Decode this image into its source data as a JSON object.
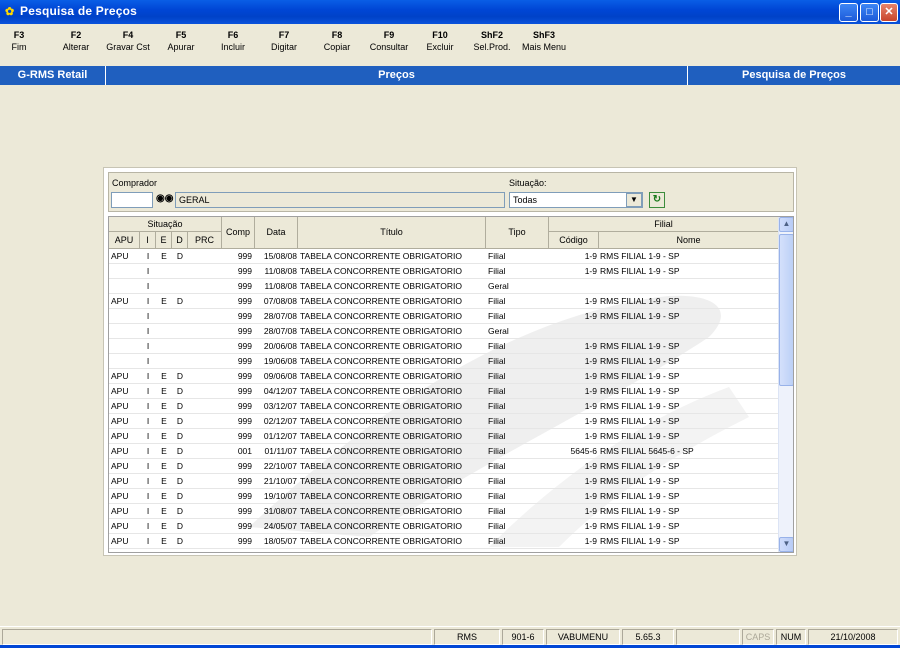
{
  "window": {
    "title": "Pesquisa de Preços"
  },
  "fkeys": [
    {
      "key": "F3",
      "label": "Fim"
    },
    {
      "key": "F2",
      "label": "Alterar"
    },
    {
      "key": "F4",
      "label": "Gravar Cst"
    },
    {
      "key": "F5",
      "label": "Apurar"
    },
    {
      "key": "F6",
      "label": "Incluir"
    },
    {
      "key": "F7",
      "label": "Digitar"
    },
    {
      "key": "F8",
      "label": "Copiar"
    },
    {
      "key": "F9",
      "label": "Consultar"
    },
    {
      "key": "F10",
      "label": "Excluir"
    },
    {
      "key": "ShF2",
      "label": "Sel.Prod."
    },
    {
      "key": "ShF3",
      "label": "Mais Menu"
    }
  ],
  "header": {
    "app": "G-RMS Retail",
    "module": "Preços",
    "screen": "Pesquisa de Preços"
  },
  "filter": {
    "comprador_label": "Comprador",
    "comprador_value": "",
    "comprador_name": "GERAL",
    "situacao_label": "Situação:",
    "situacao_value": "Todas"
  },
  "grid": {
    "group_situacao": "Situação",
    "group_filial": "Filial",
    "columns": {
      "apu": "APU",
      "i": "I",
      "e": "E",
      "d": "D",
      "prc": "PRC",
      "comp": "Comp",
      "data": "Data",
      "titulo": "Título",
      "tipo": "Tipo",
      "codigo": "Código",
      "nome": "Nome"
    },
    "rows": [
      {
        "apu": "APU",
        "i": "I",
        "e": "E",
        "d": "D",
        "prc": "",
        "comp": "999",
        "data": "15/08/08",
        "titulo": "TABELA CONCORRENTE OBRIGATORIO",
        "tipo": "Filial",
        "codigo": "1-9",
        "nome": "RMS FILIAL 1-9 - SP"
      },
      {
        "apu": "",
        "i": "I",
        "e": "",
        "d": "",
        "prc": "",
        "comp": "999",
        "data": "11/08/08",
        "titulo": "TABELA CONCORRENTE OBRIGATORIO",
        "tipo": "Filial",
        "codigo": "1-9",
        "nome": "RMS FILIAL 1-9 - SP"
      },
      {
        "apu": "",
        "i": "I",
        "e": "",
        "d": "",
        "prc": "",
        "comp": "999",
        "data": "11/08/08",
        "titulo": "TABELA CONCORRENTE OBRIGATORIO",
        "tipo": "Geral",
        "codigo": "",
        "nome": ""
      },
      {
        "apu": "APU",
        "i": "I",
        "e": "E",
        "d": "D",
        "prc": "",
        "comp": "999",
        "data": "07/08/08",
        "titulo": "TABELA CONCORRENTE OBRIGATORIO",
        "tipo": "Filial",
        "codigo": "1-9",
        "nome": "RMS FILIAL 1-9 - SP"
      },
      {
        "apu": "",
        "i": "I",
        "e": "",
        "d": "",
        "prc": "",
        "comp": "999",
        "data": "28/07/08",
        "titulo": "TABELA CONCORRENTE OBRIGATORIO",
        "tipo": "Filial",
        "codigo": "1-9",
        "nome": "RMS FILIAL 1-9 - SP"
      },
      {
        "apu": "",
        "i": "I",
        "e": "",
        "d": "",
        "prc": "",
        "comp": "999",
        "data": "28/07/08",
        "titulo": "TABELA CONCORRENTE OBRIGATORIO",
        "tipo": "Geral",
        "codigo": "",
        "nome": ""
      },
      {
        "apu": "",
        "i": "I",
        "e": "",
        "d": "",
        "prc": "",
        "comp": "999",
        "data": "20/06/08",
        "titulo": "TABELA CONCORRENTE OBRIGATORIO",
        "tipo": "Filial",
        "codigo": "1-9",
        "nome": "RMS FILIAL 1-9 - SP"
      },
      {
        "apu": "",
        "i": "I",
        "e": "",
        "d": "",
        "prc": "",
        "comp": "999",
        "data": "19/06/08",
        "titulo": "TABELA CONCORRENTE OBRIGATORIO",
        "tipo": "Filial",
        "codigo": "1-9",
        "nome": "RMS FILIAL 1-9 - SP"
      },
      {
        "apu": "APU",
        "i": "I",
        "e": "E",
        "d": "D",
        "prc": "",
        "comp": "999",
        "data": "09/06/08",
        "titulo": "TABELA CONCORRENTE OBRIGATORIO",
        "tipo": "Filial",
        "codigo": "1-9",
        "nome": "RMS FILIAL 1-9 - SP"
      },
      {
        "apu": "APU",
        "i": "I",
        "e": "E",
        "d": "D",
        "prc": "",
        "comp": "999",
        "data": "04/12/07",
        "titulo": "TABELA CONCORRENTE OBRIGATORIO",
        "tipo": "Filial",
        "codigo": "1-9",
        "nome": "RMS FILIAL 1-9 - SP"
      },
      {
        "apu": "APU",
        "i": "I",
        "e": "E",
        "d": "D",
        "prc": "",
        "comp": "999",
        "data": "03/12/07",
        "titulo": "TABELA CONCORRENTE OBRIGATORIO",
        "tipo": "Filial",
        "codigo": "1-9",
        "nome": "RMS FILIAL 1-9 - SP"
      },
      {
        "apu": "APU",
        "i": "I",
        "e": "E",
        "d": "D",
        "prc": "",
        "comp": "999",
        "data": "02/12/07",
        "titulo": "TABELA CONCORRENTE OBRIGATORIO",
        "tipo": "Filial",
        "codigo": "1-9",
        "nome": "RMS FILIAL 1-9 - SP"
      },
      {
        "apu": "APU",
        "i": "I",
        "e": "E",
        "d": "D",
        "prc": "",
        "comp": "999",
        "data": "01/12/07",
        "titulo": "TABELA CONCORRENTE OBRIGATORIO",
        "tipo": "Filial",
        "codigo": "1-9",
        "nome": "RMS FILIAL 1-9 - SP"
      },
      {
        "apu": "APU",
        "i": "I",
        "e": "E",
        "d": "D",
        "prc": "",
        "comp": "001",
        "data": "01/11/07",
        "titulo": "TABELA CONCORRENTE OBRIGATORIO",
        "tipo": "Filial",
        "codigo": "5645-6",
        "nome": "RMS FILIAL 5645-6 - SP"
      },
      {
        "apu": "APU",
        "i": "I",
        "e": "E",
        "d": "D",
        "prc": "",
        "comp": "999",
        "data": "22/10/07",
        "titulo": "TABELA CONCORRENTE OBRIGATORIO",
        "tipo": "Filial",
        "codigo": "1-9",
        "nome": "RMS FILIAL 1-9 - SP"
      },
      {
        "apu": "APU",
        "i": "I",
        "e": "E",
        "d": "D",
        "prc": "",
        "comp": "999",
        "data": "21/10/07",
        "titulo": "TABELA CONCORRENTE OBRIGATORIO",
        "tipo": "Filial",
        "codigo": "1-9",
        "nome": "RMS FILIAL 1-9 - SP"
      },
      {
        "apu": "APU",
        "i": "I",
        "e": "E",
        "d": "D",
        "prc": "",
        "comp": "999",
        "data": "19/10/07",
        "titulo": "TABELA CONCORRENTE OBRIGATORIO",
        "tipo": "Filial",
        "codigo": "1-9",
        "nome": "RMS FILIAL 1-9 - SP"
      },
      {
        "apu": "APU",
        "i": "I",
        "e": "E",
        "d": "D",
        "prc": "",
        "comp": "999",
        "data": "31/08/07",
        "titulo": "TABELA CONCORRENTE OBRIGATORIO",
        "tipo": "Filial",
        "codigo": "1-9",
        "nome": "RMS FILIAL 1-9 - SP"
      },
      {
        "apu": "APU",
        "i": "I",
        "e": "E",
        "d": "D",
        "prc": "",
        "comp": "999",
        "data": "24/05/07",
        "titulo": "TABELA CONCORRENTE OBRIGATORIO",
        "tipo": "Filial",
        "codigo": "1-9",
        "nome": "RMS FILIAL 1-9 - SP"
      },
      {
        "apu": "APU",
        "i": "I",
        "e": "E",
        "d": "D",
        "prc": "",
        "comp": "999",
        "data": "18/05/07",
        "titulo": "TABELA CONCORRENTE OBRIGATORIO",
        "tipo": "Filial",
        "codigo": "1-9",
        "nome": "RMS FILIAL 1-9 - SP"
      }
    ]
  },
  "status": {
    "system": "RMS",
    "code": "901-6",
    "menu": "VABUMENU",
    "version": "5.65.3",
    "caps": "CAPS",
    "num": "NUM",
    "date": "21/10/2008"
  },
  "colors": {
    "titlebar": "#0046d5",
    "header": "#1f5fbf",
    "face": "#ece9d8"
  }
}
